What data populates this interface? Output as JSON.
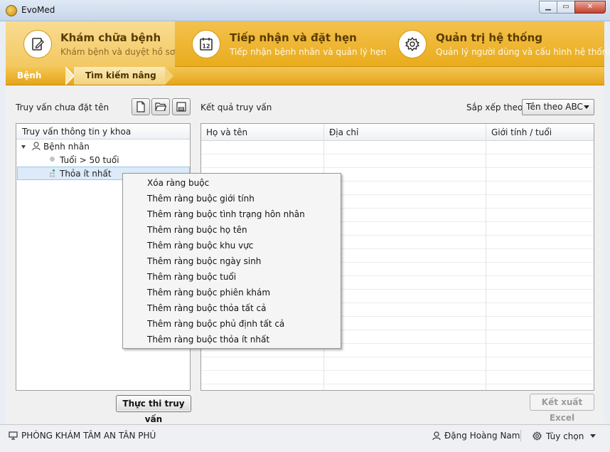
{
  "window": {
    "title": "EvoMed"
  },
  "modules": [
    {
      "title": "Khám chữa bệnh",
      "subtitle": "Khám bệnh và duyệt hồ sơ",
      "icon": "document-edit-icon",
      "active": true
    },
    {
      "title": "Tiếp nhận và đặt hẹn",
      "subtitle": "Tiếp nhận bệnh nhân và quản lý hẹn",
      "icon": "calendar-icon",
      "calendar_day": "12"
    },
    {
      "title": "Quản trị hệ thống",
      "subtitle": "Quản lý người dùng và cấu hình hệ thống",
      "icon": "gear-icon"
    }
  ],
  "breadcrumb": [
    "Bệnh nhân",
    "Tìm kiếm nâng cao"
  ],
  "left_panel": {
    "query_name": "Truy vấn chưa đặt tên",
    "tree_header": "Truy vấn thông tin y khoa",
    "tree": {
      "root": "Bệnh nhân",
      "children": [
        "Tuổi > 50 tuổi",
        "Thỏa ít nhất"
      ]
    },
    "execute_button": "Thực thi truy vấn"
  },
  "right_panel": {
    "results_label": "Kết quả truy vấn",
    "sort_label": "Sắp xếp theo:",
    "sort_value": "Tên theo ABC",
    "columns": [
      "Họ và tên",
      "Địa chỉ",
      "Giới tính / tuổi"
    ],
    "export_button": "Kết xuất Excel"
  },
  "context_menu": [
    "Xóa ràng buộc",
    "Thêm ràng buộc giới tính",
    "Thêm ràng buộc tình trạng hôn nhân",
    "Thêm ràng buộc họ tên",
    "Thêm ràng buộc khu vực",
    "Thêm ràng buộc ngày sinh",
    "Thêm ràng buộc tuổi",
    "Thêm ràng buộc phiên khám",
    "Thêm ràng buộc thỏa tất cả",
    "Thêm ràng buộc phủ định tất cả",
    "Thêm ràng buộc thỏa ít nhất"
  ],
  "status": {
    "clinic": "PHÒNG KHÁM TÂM AN TÂN PHÚ",
    "user": "Đặng Hoàng Nam",
    "options": "Tùy chọn"
  },
  "colors": {
    "accent": "#e9ac1c",
    "accent_light": "#f9dc93",
    "title_text": "#5a3b00"
  }
}
